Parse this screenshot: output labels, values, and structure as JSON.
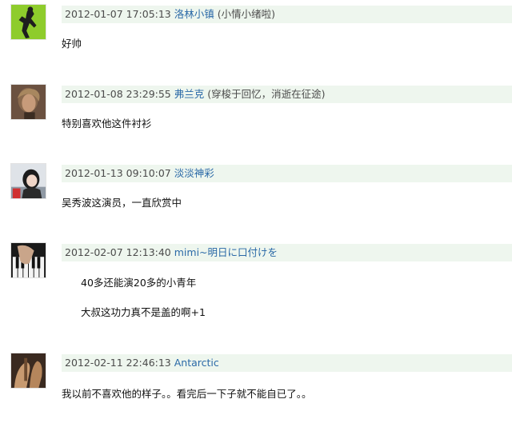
{
  "comments": [
    {
      "time": "2012-01-07 17:05:13",
      "user": "洛林小镇",
      "signature": "(小情小绪啦)",
      "lines": [
        "好帅"
      ],
      "avatar_icon": "silhouette-dancer-avatar"
    },
    {
      "time": "2012-01-08 23:29:55",
      "user": "弗兰克",
      "signature": "(穿梭于回忆，消逝在征途)",
      "lines": [
        "特别喜欢他这件衬衫"
      ],
      "avatar_icon": "man-portrait-avatar"
    },
    {
      "time": "2012-01-13 09:10:07",
      "user": "淡淡神彩",
      "signature": "",
      "lines": [
        "吴秀波这演员，一直欣赏中"
      ],
      "avatar_icon": "girl-portrait-avatar"
    },
    {
      "time": "2012-02-07 12:13:40",
      "user": "mimi~明日に口付けを",
      "signature": "",
      "lines": [
        "40多还能演20多的小青年",
        "大叔这功力真不是盖的啊+1"
      ],
      "avatar_icon": "piano-hands-avatar"
    },
    {
      "time": "2012-02-11 22:46:13",
      "user": "Antarctic",
      "signature": "",
      "lines": [
        "我以前不喜欢他的样子。。看完后一下子就不能自已了。。"
      ],
      "avatar_icon": "hands-avatar"
    }
  ]
}
